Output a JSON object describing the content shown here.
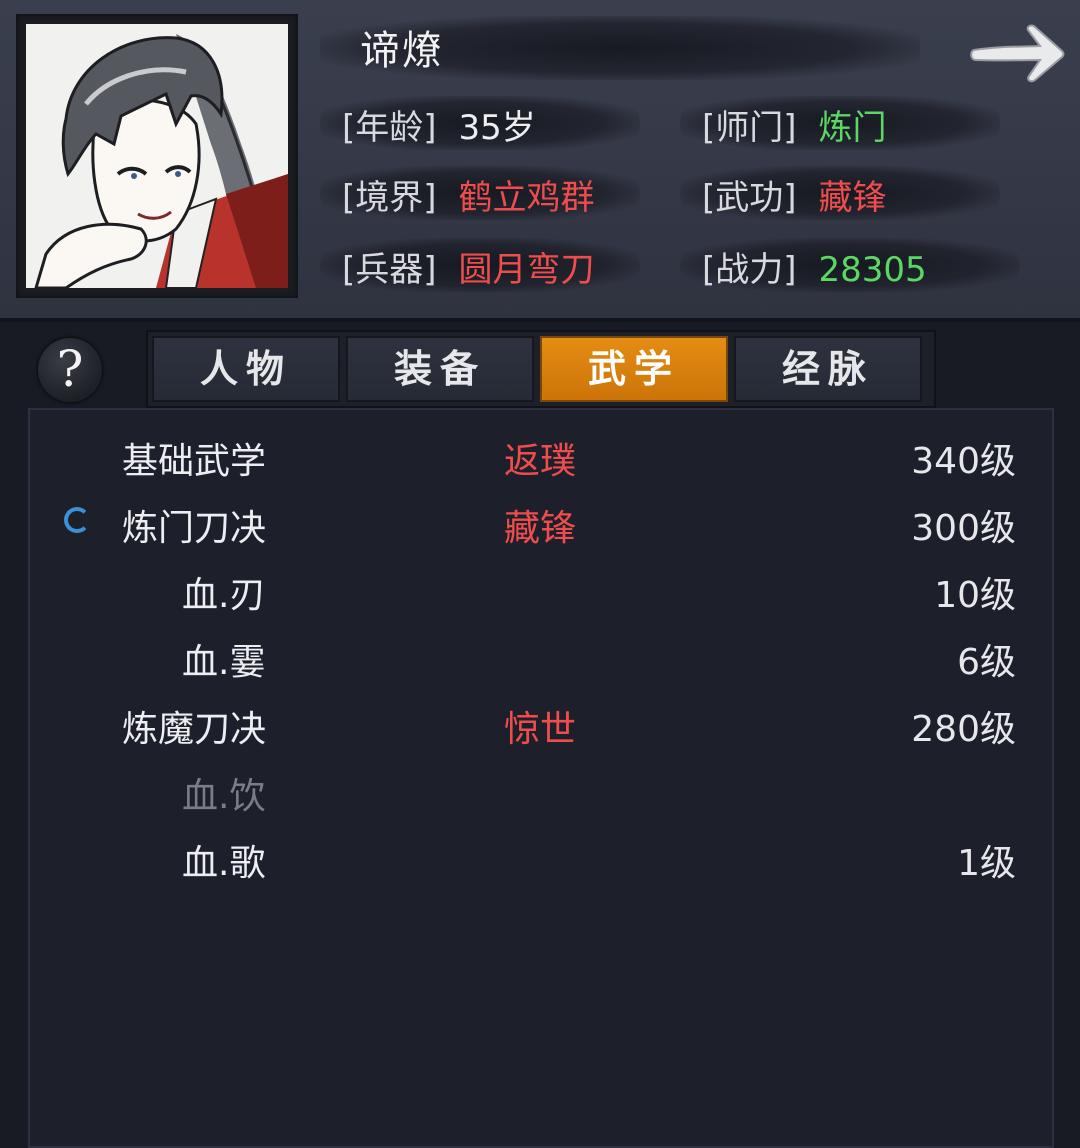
{
  "character": {
    "name": "谛燎",
    "fields": [
      {
        "label": "[年龄]",
        "value": "35岁",
        "color": "#eceef2"
      },
      {
        "label": "[师门]",
        "value": "炼门",
        "color": "#5bd864"
      },
      {
        "label": "[境界]",
        "value": "鹤立鸡群",
        "color": "#ef4d4d"
      },
      {
        "label": "[武功]",
        "value": "藏锋",
        "color": "#ef4d4d"
      },
      {
        "label": "[兵器]",
        "value": "圆月弯刀",
        "color": "#ef4d4d"
      },
      {
        "label": "[战力]",
        "value": "28305",
        "color": "#5bd864"
      }
    ]
  },
  "help": {
    "label": "?"
  },
  "tabs": [
    {
      "label": "人物",
      "active": false
    },
    {
      "label": "装备",
      "active": false
    },
    {
      "label": "武学",
      "active": true
    },
    {
      "label": "经脉",
      "active": false
    }
  ],
  "skills": [
    {
      "name": "基础武学",
      "tag": "返璞",
      "level": "340级",
      "sub": false,
      "dim": false,
      "icon": null
    },
    {
      "name": "炼门刀决",
      "tag": "藏锋",
      "level": "300级",
      "sub": false,
      "dim": false,
      "icon": "loading-ring-icon"
    },
    {
      "name": "血.刃",
      "tag": "",
      "level": "10级",
      "sub": true,
      "dim": false,
      "icon": null
    },
    {
      "name": "血.霎",
      "tag": "",
      "level": "6级",
      "sub": true,
      "dim": false,
      "icon": null
    },
    {
      "name": "炼魔刀决",
      "tag": "惊世",
      "level": "280级",
      "sub": false,
      "dim": false,
      "icon": null
    },
    {
      "name": "血.饮",
      "tag": "",
      "level": "",
      "sub": true,
      "dim": true,
      "icon": null
    },
    {
      "name": "血.歌",
      "tag": "",
      "level": "1级",
      "sub": true,
      "dim": false,
      "icon": null
    }
  ],
  "colors": {
    "accent_tab": "#e58c14",
    "red_text": "#ef4d4d",
    "green_text": "#5bd864",
    "spinner": "#3d8fd8"
  }
}
